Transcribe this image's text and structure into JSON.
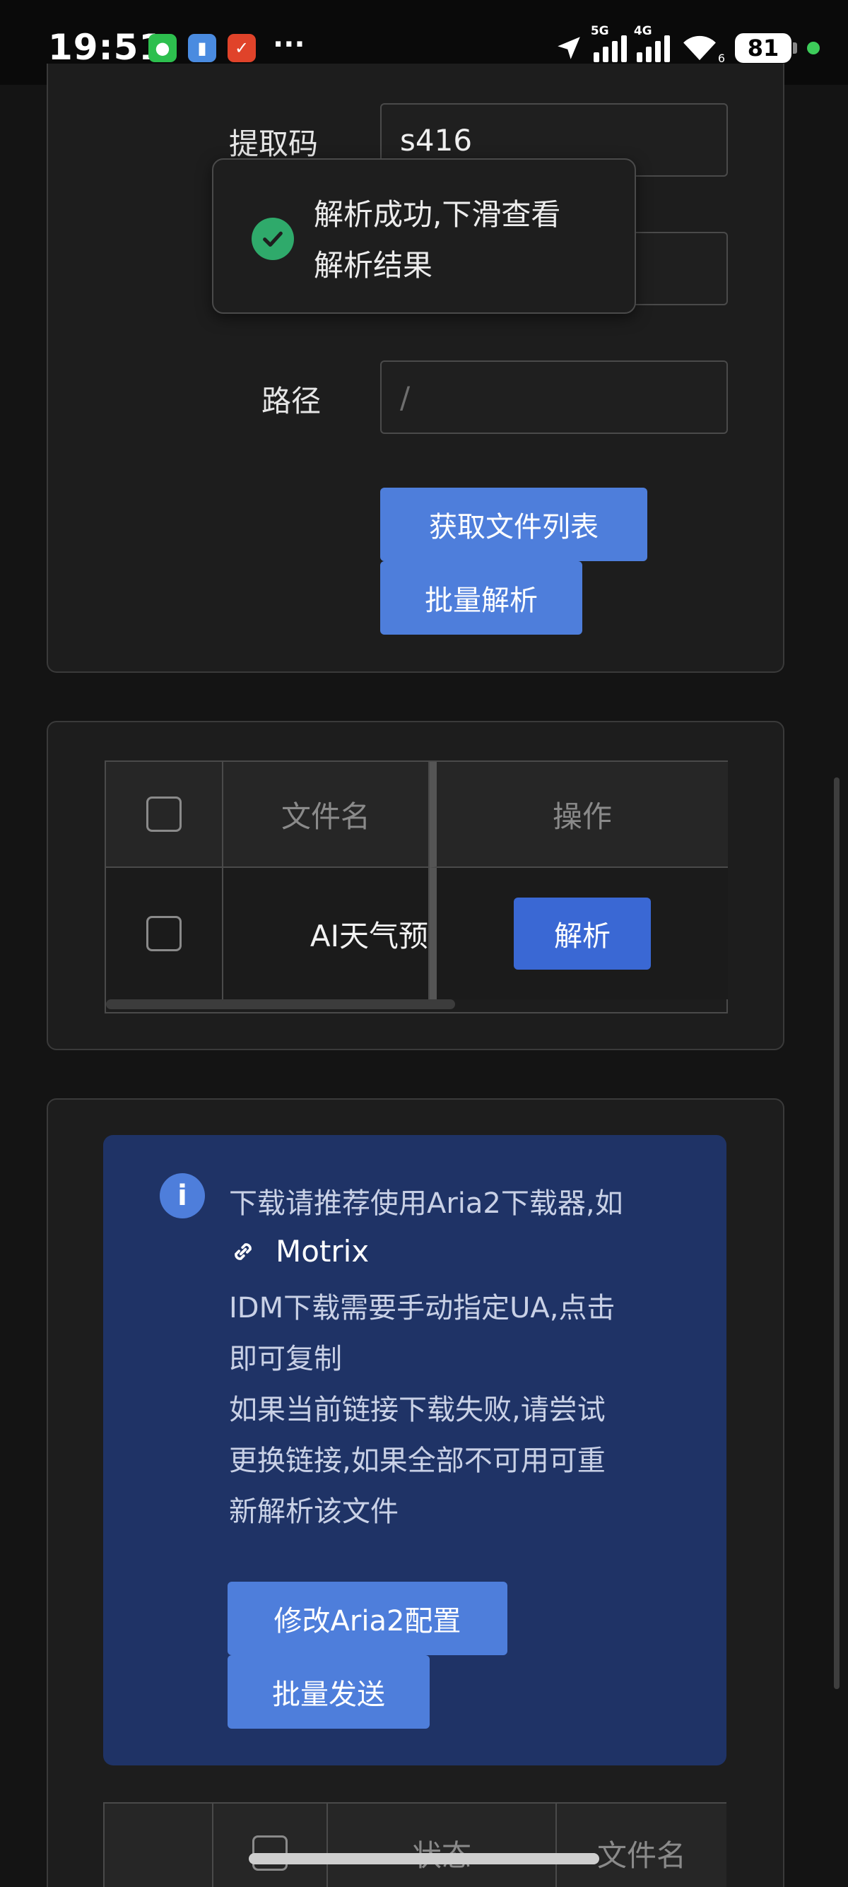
{
  "status_bar": {
    "time": "19:51",
    "more": "···",
    "net1": "5G",
    "net2": "4G",
    "wifi_sub": "6",
    "battery": "81"
  },
  "form": {
    "code_label": "提取码",
    "code_value": "s416",
    "path_label": "路径",
    "path_value": "/",
    "get_list_button": "获取文件列表",
    "batch_parse_button": "批量解析"
  },
  "toast": {
    "line1": "解析成功,下滑查看",
    "line2": "解析结果"
  },
  "file_table": {
    "col_name": "文件名",
    "col_action": "操作",
    "rows": [
      {
        "name": "AI天气预",
        "action": "解析"
      }
    ]
  },
  "alert": {
    "line1": "下载请推荐使用Aria2下载器,如",
    "link_text": "Motrix",
    "line2": "IDM下载需要手动指定UA,点击",
    "line3": "即可复制",
    "line4": "如果当前链接下载失败,请尝试",
    "line5": "更换链接,如果全部不可用可重",
    "line6": "新解析该文件",
    "aria2_button": "修改Aria2配置",
    "batch_send_button": "批量发送"
  },
  "link_table": {
    "col_status": "状态",
    "col_name": "文件名"
  },
  "colors": {
    "primary": "#4e7edb",
    "alert_bg": "#1f3366",
    "success": "#2faa6b"
  }
}
